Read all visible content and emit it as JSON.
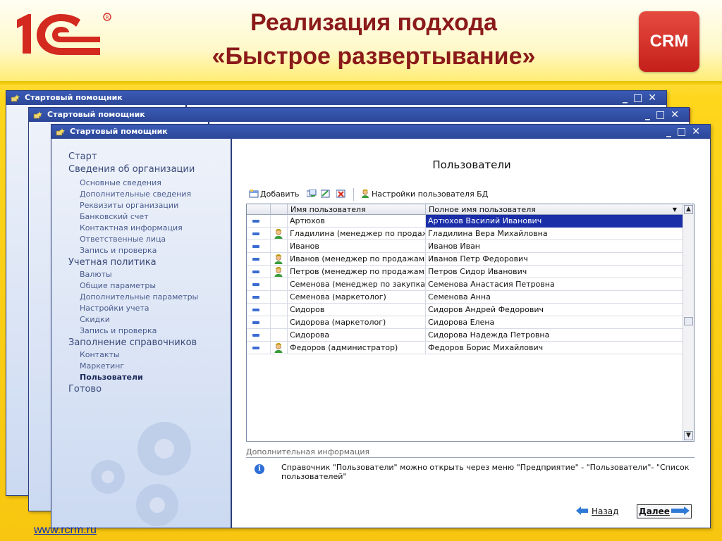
{
  "slide": {
    "title_line1": "Реализация подхода",
    "title_line2": "«Быстрое развертывание»",
    "crm_badge": "CRM",
    "footer_url": "www.rcrm.ru",
    "logo": "1C",
    "colors": {
      "title": "#8b1a1a",
      "background": "#f8c610",
      "crm_badge": "#d3291f"
    }
  },
  "windows": [
    {
      "title": "Стартовый помощник",
      "controls": [
        "_",
        "□",
        "✕"
      ]
    },
    {
      "title": "Стартовый помощник",
      "controls": [
        "_",
        "□",
        "✕"
      ]
    },
    {
      "title": "Стартовый помощник",
      "controls": [
        "_",
        "□",
        "✕"
      ]
    }
  ],
  "nav": {
    "start": "Старт",
    "org": "Сведения об организации",
    "org_items": [
      "Основные сведения",
      "Дополнительные сведения",
      "Реквизиты организации",
      "Банковский счет",
      "Контактная информация",
      "Ответственные лица",
      "Запись и проверка"
    ],
    "accounting": "Учетная политика",
    "accounting_items": [
      "Валюты",
      "Общие параметры",
      "Дополнительные параметры",
      "Настройки учета",
      "Скидки",
      "Запись и проверка"
    ],
    "refs": "Заполнение справочников",
    "refs_items": [
      "Контакты",
      "Маркетинг",
      "Пользователи"
    ],
    "done": "Готово",
    "current": "Пользователи"
  },
  "page": {
    "heading": "Пользователи",
    "toolbar": {
      "add": "Добавить",
      "db_settings": "Настройки пользователя БД"
    },
    "grid": {
      "columns": [
        "Имя пользователя",
        "Полное имя пользователя"
      ],
      "rows": [
        {
          "name": "Артюхов",
          "full": "Артюхов Василий Иванович",
          "manager_icon": false,
          "selected": true
        },
        {
          "name": "Гладилина  (менеджер по продаж...",
          "full": "Гладилина Вера Михайловна",
          "manager_icon": true,
          "selected": false
        },
        {
          "name": "Иванов",
          "full": "Иванов Иван",
          "manager_icon": false,
          "selected": false
        },
        {
          "name": "Иванов (менеджер по продажам)",
          "full": "Иванов Петр Федорович",
          "manager_icon": true,
          "selected": false
        },
        {
          "name": "Петров (менеджер по продажам)",
          "full": "Петров Сидор Иванович",
          "manager_icon": true,
          "selected": false
        },
        {
          "name": "Семенова (менеджер по закупкам)",
          "full": "Семенова Анастасия Петровна",
          "manager_icon": false,
          "selected": false
        },
        {
          "name": "Семенова (маркетолог)",
          "full": "Семенова Анна",
          "manager_icon": false,
          "selected": false
        },
        {
          "name": "Сидоров",
          "full": "Сидоров Андрей Федорович",
          "manager_icon": false,
          "selected": false
        },
        {
          "name": "Сидорова (маркетолог)",
          "full": "Сидорова Елена",
          "manager_icon": false,
          "selected": false
        },
        {
          "name": "Сидорова",
          "full": "Сидорова Надежда Петровна",
          "manager_icon": false,
          "selected": false
        },
        {
          "name": "Федоров (администратор)",
          "full": "Федоров Борис Михайлович",
          "manager_icon": true,
          "selected": false
        }
      ]
    },
    "info": {
      "heading": "Дополнительная информация",
      "text": "Справочник  \"Пользователи\" можно открыть через меню  \"Предприятие\" - \"Пользователи\"- \"Список пользователей\""
    },
    "buttons": {
      "back": "Назад",
      "next": "Далее"
    }
  }
}
